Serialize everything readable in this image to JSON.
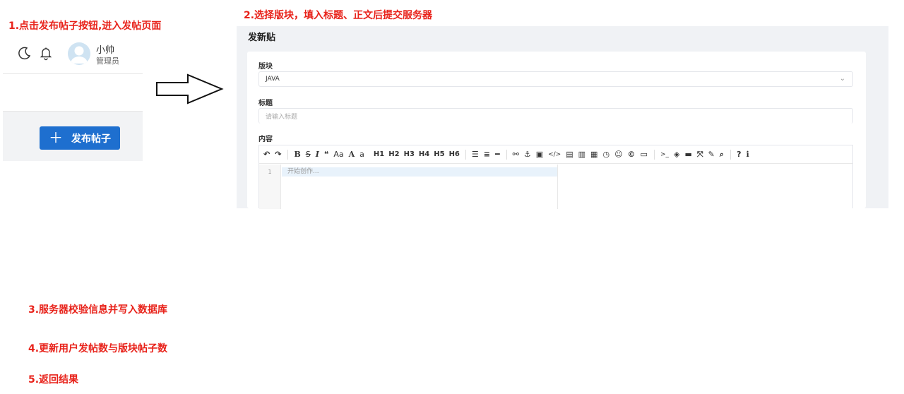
{
  "steps": {
    "s1": "1.点击发布帖子按钮,进入发帖页面",
    "s2": "2.选择版块，填入标题、正文后提交服务器",
    "s3": "3.服务器校验信息并写入数据库",
    "s4": "4.更新用户发帖数与版块帖子数",
    "s5": "5.返回结果"
  },
  "user": {
    "name": "小帅",
    "role": "管理员"
  },
  "post_button": {
    "label": "发布帖子",
    "icon": "plus-icon"
  },
  "editor": {
    "page_title": "发新贴",
    "section_label": "版块",
    "section_value": "JAVA",
    "title_label": "标题",
    "title_placeholder": "请输入标题",
    "content_label": "内容",
    "line_number": "1",
    "content_placeholder": "开始创作...",
    "toolbar": {
      "heading_buttons": [
        "H1",
        "H2",
        "H3",
        "H4",
        "H5",
        "H6"
      ]
    }
  },
  "colors": {
    "step_red": "#e8231b",
    "primary_blue": "#1e6fcf",
    "panel_bg": "#f0f2f5"
  }
}
